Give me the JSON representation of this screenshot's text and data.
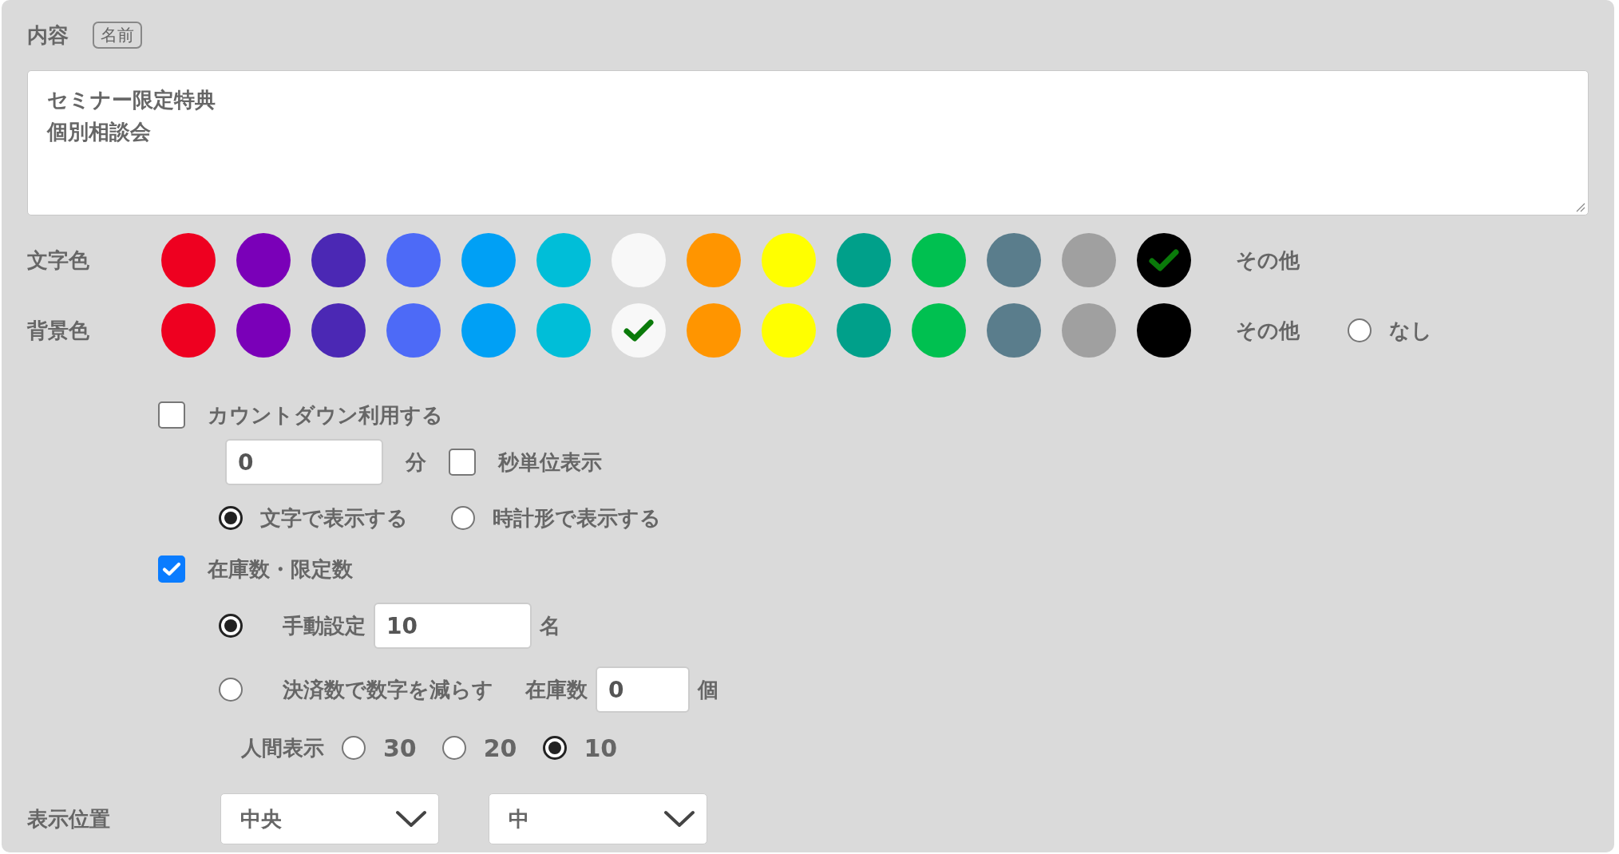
{
  "header": {
    "title": "内容",
    "badge": "名前"
  },
  "content": {
    "lines": [
      "セミナー限定特典",
      "個別相談会"
    ]
  },
  "text_color": {
    "label": "文字色",
    "other": "その他",
    "swatches": [
      {
        "color": "#ee0020",
        "selected": false
      },
      {
        "color": "#7a00b8",
        "selected": false
      },
      {
        "color": "#4b28b4",
        "selected": false
      },
      {
        "color": "#4d6af7",
        "selected": false
      },
      {
        "color": "#00a0f5",
        "selected": false
      },
      {
        "color": "#00bed8",
        "selected": false
      },
      {
        "color": "#f8f8f8",
        "selected": false
      },
      {
        "color": "#ff9500",
        "selected": false
      },
      {
        "color": "#ffff00",
        "selected": false
      },
      {
        "color": "#00a08a",
        "selected": false
      },
      {
        "color": "#00c050",
        "selected": false
      },
      {
        "color": "#5a7d8c",
        "selected": false
      },
      {
        "color": "#a0a0a0",
        "selected": false
      },
      {
        "color": "#000000",
        "selected": true
      }
    ]
  },
  "background_color": {
    "label": "背景色",
    "other": "その他",
    "none": {
      "label": "なし",
      "selected": false
    },
    "swatches": [
      {
        "color": "#ee0020",
        "selected": false
      },
      {
        "color": "#7a00b8",
        "selected": false
      },
      {
        "color": "#4b28b4",
        "selected": false
      },
      {
        "color": "#4d6af7",
        "selected": false
      },
      {
        "color": "#00a0f5",
        "selected": false
      },
      {
        "color": "#00bed8",
        "selected": false
      },
      {
        "color": "#f8f8f8",
        "selected": true
      },
      {
        "color": "#ff9500",
        "selected": false
      },
      {
        "color": "#ffff00",
        "selected": false
      },
      {
        "color": "#00a08a",
        "selected": false
      },
      {
        "color": "#00c050",
        "selected": false
      },
      {
        "color": "#5a7d8c",
        "selected": false
      },
      {
        "color": "#a0a0a0",
        "selected": false
      },
      {
        "color": "#000000",
        "selected": false
      }
    ]
  },
  "countdown": {
    "label": "カウントダウン利用する",
    "checked": false,
    "minutes": {
      "value": "0",
      "unit": "分"
    },
    "seconds": {
      "label": "秒単位表示",
      "checked": false
    },
    "display_modes": [
      {
        "label": "文字で表示する",
        "selected": true
      },
      {
        "label": "時計形で表示する",
        "selected": false
      }
    ]
  },
  "stock": {
    "label": "在庫数・限定数",
    "checked": true,
    "modes": [
      {
        "kind": "manual",
        "label": "手動設定",
        "value": "10",
        "unit": "名",
        "selected": true
      },
      {
        "kind": "payment",
        "label": "決済数で数字を減らす",
        "stock_label": "在庫数",
        "value": "0",
        "unit": "個",
        "selected": false
      }
    ],
    "people_display": {
      "label": "人間表示",
      "options": [
        {
          "label": "30",
          "selected": false
        },
        {
          "label": "20",
          "selected": false
        },
        {
          "label": "10",
          "selected": true
        }
      ]
    }
  },
  "position": {
    "label": "表示位置",
    "selects": [
      {
        "value": "中央"
      },
      {
        "value": "中"
      }
    ]
  }
}
